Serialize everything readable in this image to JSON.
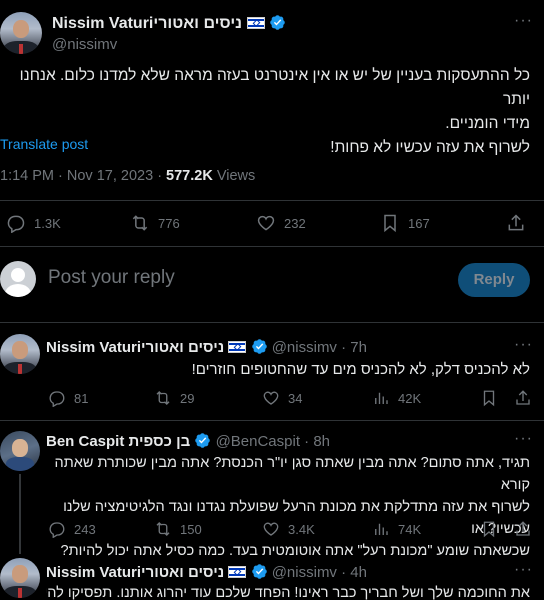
{
  "main_tweet": {
    "display_name": "Nissim Vaturiניסים ואטורי",
    "handle": "@nissimv",
    "text_line1": "כל ההתעסקות בעניין של יש או אין אינטרנט בעזה מראה שלא למדנו כלום. אנחנו יותר",
    "text_line2": "מידי הומניים.",
    "text_line3": "לשרוף את עזה עכשיו לא פחות!",
    "translate": "Translate post",
    "time": "1:14 PM · Nov 17, 2023",
    "views_count": "577.2K",
    "views_label": "Views",
    "replies": "1.3K",
    "reposts": "776",
    "likes": "232",
    "bookmarks": "167"
  },
  "reply_box": {
    "placeholder": "Post your reply",
    "button": "Reply"
  },
  "replies": [
    {
      "display_name": "Nissim Vaturiניסים ואטורי",
      "handle": "@nissimv",
      "time": "· 7h",
      "text": "לא להכניס דלק, לא להכניס מים עד שהחטופים חוזרים!",
      "replies": "81",
      "reposts": "29",
      "likes": "34",
      "views": "42K"
    },
    {
      "display_name": "Ben Caspit בן כספית",
      "handle": "@BenCaspit",
      "time": "· 8h",
      "text_line1": "תגיד, אתה סתום? אתה מבין שאתה סגן יו\"ר הכנסת? אתה מבין שכותרת שאתה קורא",
      "text_line2": "לשרוף את עזה מתדלקת את מכונת הרעל שפועלת נגדנו ונגד הלגיטימציה שלנו עכשיו? או",
      "text_line3": "שכשאתה שומע \"מכונת רעל\" אתה אוטומטית בעד. כמה כסיל אתה יכול להיות?",
      "replies": "243",
      "reposts": "150",
      "likes": "3.4K",
      "views": "74K"
    },
    {
      "display_name": "Nissim Vaturiניסים ואטורי",
      "handle": "@nissimv",
      "time": "· 4h",
      "text": "את החוכמה שלך ושל חבריך כבר ראינו! הפחד שלכם עוד יהרוג אותנו. תפסיקו להיות"
    }
  ],
  "colors": {
    "accent": "#1d9bf0",
    "muted": "#71767b",
    "divider": "#2f3336",
    "reply_button_bg": "#0f4e78"
  }
}
